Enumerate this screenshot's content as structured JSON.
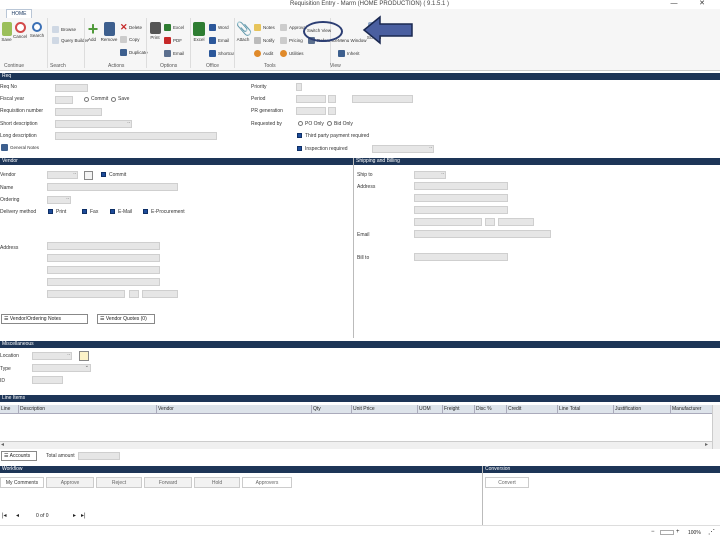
{
  "window": {
    "title": "Requisition Entry - Marm (HOME PRODUCTION) ( 9.1.5.1 )",
    "minimize": "—",
    "close": "✕"
  },
  "ribbon": {
    "tab": "HOME",
    "groups": {
      "continue": "Continue",
      "search": "Search",
      "actions": "Actions",
      "options": "Options",
      "office": "Office",
      "tools": "Tools",
      "view": "View"
    },
    "buttons": {
      "save": "Save",
      "cancel": "Cancel",
      "search": "Search",
      "browse": "Browse",
      "query_builder": "Query Builder",
      "add": "Add",
      "remove": "Remove",
      "delete": "Delete",
      "copy": "Copy",
      "duplicate": "Duplicate",
      "print": "Print",
      "pdf": "PDF",
      "excel": "Excel",
      "word": "Word",
      "email": "Email",
      "shortcut": "Shortcut",
      "attach": "Attach",
      "notes": "Notes",
      "notify": "Notify",
      "audit": "Audit",
      "approval": "Approval",
      "pricing": "Pricing",
      "utilities": "Utilities",
      "reference": "Reference",
      "switch_view": "Switch View",
      "menu_window": "Menu Window",
      "inherit": "Inherit",
      "screen": "Screen"
    }
  },
  "header_section": {
    "title": "Req",
    "fields": {
      "req_no": "Req No",
      "fiscal_year": "Fiscal year",
      "requisition_number": "Requisition number",
      "short_description": "Short description",
      "long_description": "Long description",
      "priority": "Priority",
      "period": "Period",
      "pr_generation": "PR generation",
      "requested_by": "Requested by",
      "general_notes": "General Notes"
    },
    "options": {
      "commit": "Commit",
      "save": "Save",
      "po_only": "PO Only",
      "bid_only": "Bid Only"
    },
    "checks": {
      "third_party": "Third party payment required",
      "inspection": "Inspection required"
    },
    "fy_value": "",
    "period_value": "1"
  },
  "vendor_section": {
    "title": "Vendor",
    "fields": {
      "vendor": "Vendor",
      "name": "Name",
      "ordering": "Ordering",
      "delivery_method": "Delivery method",
      "address": "Address"
    },
    "commit_label": "Commit",
    "methods": [
      "Print",
      "Fax",
      "E-Mail",
      "E-Procurement"
    ],
    "btn_ordering": "Vendor/Ordering Notes",
    "btn_quotes": "Vendor Quotes (0)"
  },
  "ship_section": {
    "title": "Shipping and Billing",
    "fields": {
      "ship_to": "Ship to",
      "address": "Address",
      "email": "Email",
      "bill_to": "Bill to"
    }
  },
  "misc_section": {
    "title": "Miscellaneous",
    "fields": {
      "location": "Location",
      "type": "Type",
      "id": "ID"
    }
  },
  "lines_section": {
    "title": "Line Items",
    "columns": [
      "Line",
      "Description",
      "Vendor",
      "Qty",
      "Unit Price",
      "UOM",
      "Freight",
      "Disc %",
      "Credit",
      "Line Total",
      "Justification",
      "Manufacturer"
    ],
    "btn_accounts": "Accounts",
    "total_label": "Total amount"
  },
  "workflow_section": {
    "title": "Workflow",
    "tabs": [
      "My Comments",
      "Approve",
      "Reject",
      "Forward",
      "Hold",
      "Approvers"
    ],
    "nav_count": "0 of 0"
  },
  "conversion_section": {
    "title": "Conversion",
    "tab": "Convert"
  },
  "status": {
    "zoom": "100%"
  }
}
